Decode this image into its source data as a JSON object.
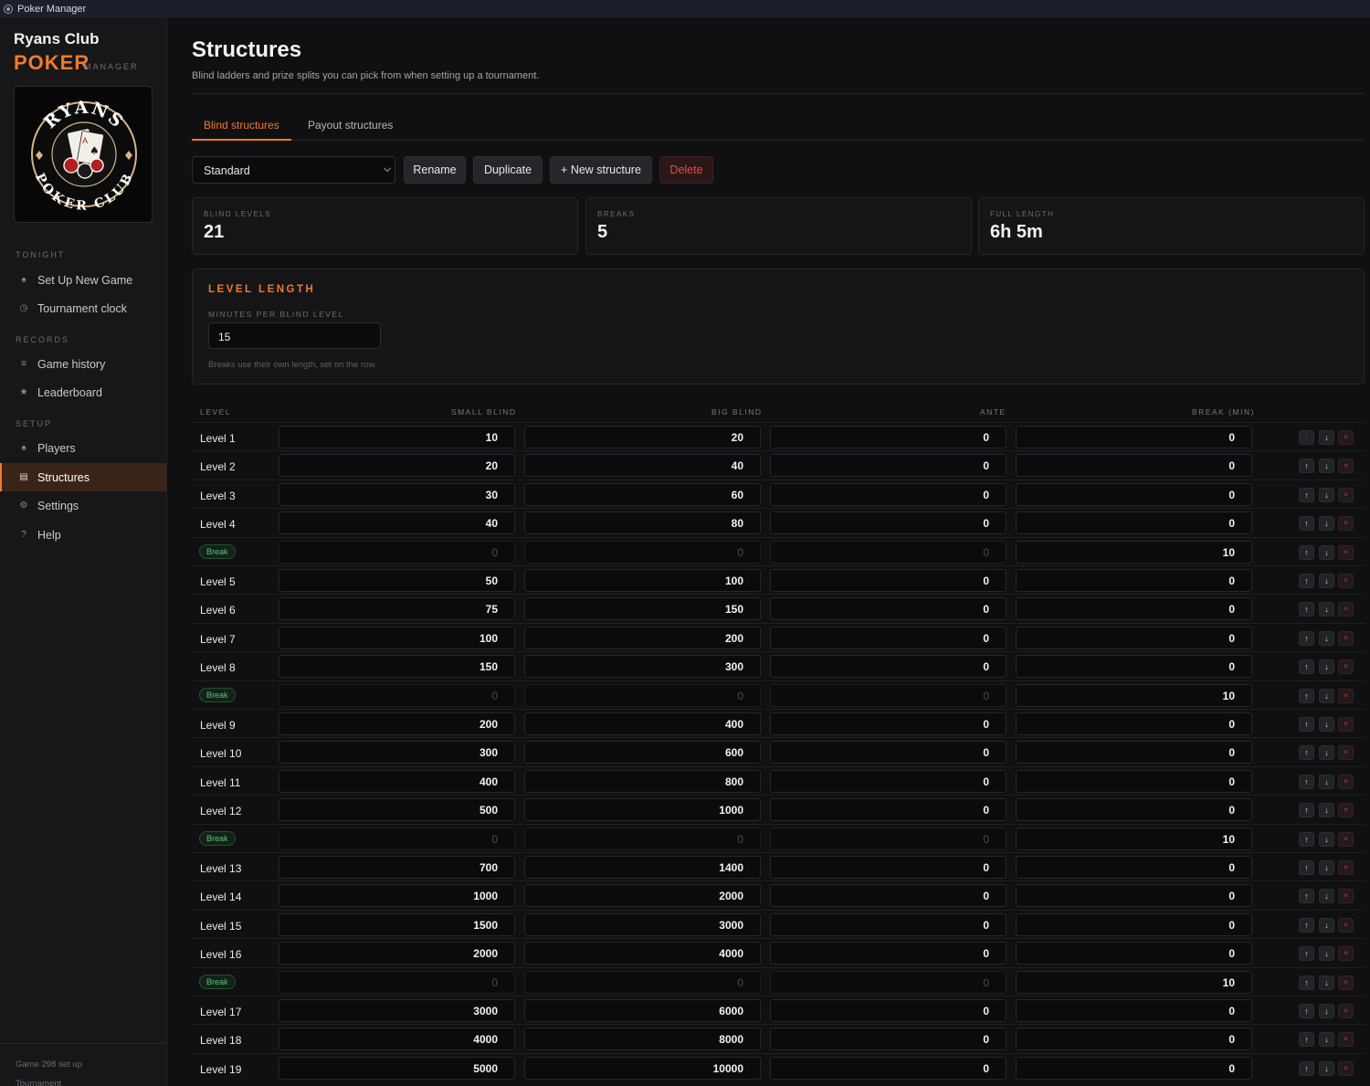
{
  "window": {
    "title": "Poker Manager"
  },
  "sidebar": {
    "club_name": "Ryans Club",
    "poker": "POKER",
    "manager": "MANAGER",
    "logo": {
      "top": "RYANS",
      "bottom": "POKER CLUB"
    },
    "sections": {
      "tonight": "TONIGHT",
      "records": "RECORDS",
      "setup": "SETUP"
    },
    "items": [
      {
        "label": "Set Up New Game",
        "icon": "spade-icon"
      },
      {
        "label": "Tournament clock",
        "icon": "clock-icon"
      },
      {
        "label": "Game history",
        "icon": "list-icon"
      },
      {
        "label": "Leaderboard",
        "icon": "star-icon"
      },
      {
        "label": "Players",
        "icon": "spade-icon"
      },
      {
        "label": "Structures",
        "icon": "grid-icon"
      },
      {
        "label": "Settings",
        "icon": "gear-icon"
      },
      {
        "label": "Help",
        "icon": "question-icon"
      }
    ],
    "footer": {
      "line1": "Game 298 set up",
      "line2": "Tournament"
    }
  },
  "page": {
    "title": "Structures",
    "subtitle": "Blind ladders and prize splits you can pick from when setting up a tournament."
  },
  "tabs": [
    {
      "label": "Blind structures",
      "active": true
    },
    {
      "label": "Payout structures",
      "active": false
    }
  ],
  "toolbar": {
    "selected_structure": "Standard",
    "rename": "Rename",
    "duplicate": "Duplicate",
    "new_structure": "+ New structure",
    "delete": "Delete"
  },
  "stats": [
    {
      "label": "BLIND LEVELS",
      "value": "21"
    },
    {
      "label": "BREAKS",
      "value": "5"
    },
    {
      "label": "FULL LENGTH",
      "value": "6h 5m"
    }
  ],
  "level_length": {
    "heading": "LEVEL LENGTH",
    "field_label": "MINUTES PER BLIND LEVEL",
    "value": "15",
    "hint": "Breaks use their own length, set on the row."
  },
  "table": {
    "headers": [
      "LEVEL",
      "SMALL BLIND",
      "BIG BLIND",
      "ANTE",
      "BREAK (MIN)"
    ],
    "break_label": "Break",
    "actions": {
      "up": "↑",
      "down": "↓",
      "delete": "×"
    },
    "rows": [
      {
        "type": "level",
        "label": "Level 1",
        "small": "10",
        "big": "20",
        "ante": "0",
        "break_min": "0"
      },
      {
        "type": "level",
        "label": "Level 2",
        "small": "20",
        "big": "40",
        "ante": "0",
        "break_min": "0"
      },
      {
        "type": "level",
        "label": "Level 3",
        "small": "30",
        "big": "60",
        "ante": "0",
        "break_min": "0"
      },
      {
        "type": "level",
        "label": "Level 4",
        "small": "40",
        "big": "80",
        "ante": "0",
        "break_min": "0"
      },
      {
        "type": "break",
        "label": "Break",
        "small": "0",
        "big": "0",
        "ante": "0",
        "break_min": "10"
      },
      {
        "type": "level",
        "label": "Level 5",
        "small": "50",
        "big": "100",
        "ante": "0",
        "break_min": "0"
      },
      {
        "type": "level",
        "label": "Level 6",
        "small": "75",
        "big": "150",
        "ante": "0",
        "break_min": "0"
      },
      {
        "type": "level",
        "label": "Level 7",
        "small": "100",
        "big": "200",
        "ante": "0",
        "break_min": "0"
      },
      {
        "type": "level",
        "label": "Level 8",
        "small": "150",
        "big": "300",
        "ante": "0",
        "break_min": "0"
      },
      {
        "type": "break",
        "label": "Break",
        "small": "0",
        "big": "0",
        "ante": "0",
        "break_min": "10"
      },
      {
        "type": "level",
        "label": "Level 9",
        "small": "200",
        "big": "400",
        "ante": "0",
        "break_min": "0"
      },
      {
        "type": "level",
        "label": "Level 10",
        "small": "300",
        "big": "600",
        "ante": "0",
        "break_min": "0"
      },
      {
        "type": "level",
        "label": "Level 11",
        "small": "400",
        "big": "800",
        "ante": "0",
        "break_min": "0"
      },
      {
        "type": "level",
        "label": "Level 12",
        "small": "500",
        "big": "1000",
        "ante": "0",
        "break_min": "0"
      },
      {
        "type": "break",
        "label": "Break",
        "small": "0",
        "big": "0",
        "ante": "0",
        "break_min": "10"
      },
      {
        "type": "level",
        "label": "Level 13",
        "small": "700",
        "big": "1400",
        "ante": "0",
        "break_min": "0"
      },
      {
        "type": "level",
        "label": "Level 14",
        "small": "1000",
        "big": "2000",
        "ante": "0",
        "break_min": "0"
      },
      {
        "type": "level",
        "label": "Level 15",
        "small": "1500",
        "big": "3000",
        "ante": "0",
        "break_min": "0"
      },
      {
        "type": "level",
        "label": "Level 16",
        "small": "2000",
        "big": "4000",
        "ante": "0",
        "break_min": "0"
      },
      {
        "type": "break",
        "label": "Break",
        "small": "0",
        "big": "0",
        "ante": "0",
        "break_min": "10"
      },
      {
        "type": "level",
        "label": "Level 17",
        "small": "3000",
        "big": "6000",
        "ante": "0",
        "break_min": "0"
      },
      {
        "type": "level",
        "label": "Level 18",
        "small": "4000",
        "big": "8000",
        "ante": "0",
        "break_min": "0"
      },
      {
        "type": "level",
        "label": "Level 19",
        "small": "5000",
        "big": "10000",
        "ante": "0",
        "break_min": "0"
      }
    ]
  },
  "colors": {
    "accent": "#f07a2c",
    "danger": "#e24c4c",
    "break_green": "#5ec27b"
  }
}
